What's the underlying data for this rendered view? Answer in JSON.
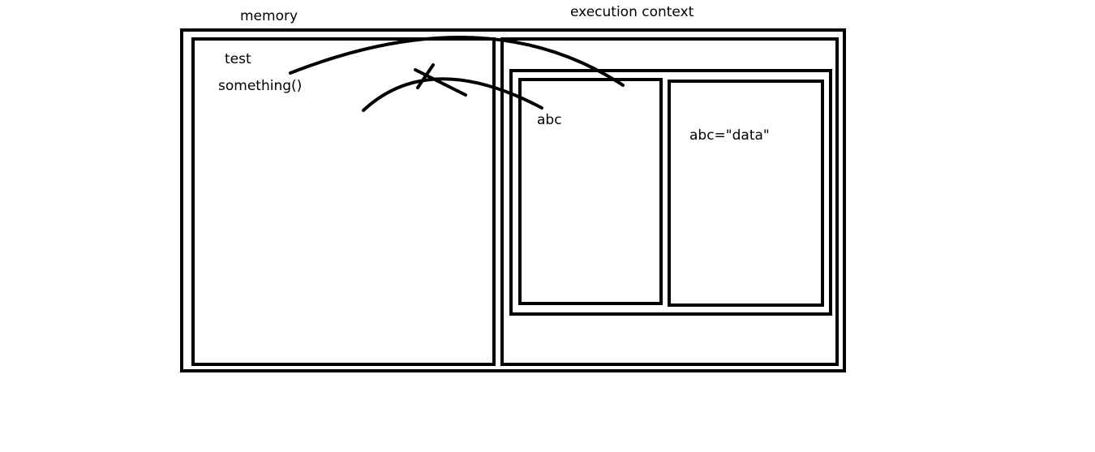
{
  "labels": {
    "memory": "memory",
    "execution_context": "execution context",
    "test": "test",
    "something": "something()",
    "abc": "abc",
    "abc_assignment": "abc=\"data\""
  },
  "colors": {
    "stroke": "#000000",
    "background": "#ffffff"
  }
}
